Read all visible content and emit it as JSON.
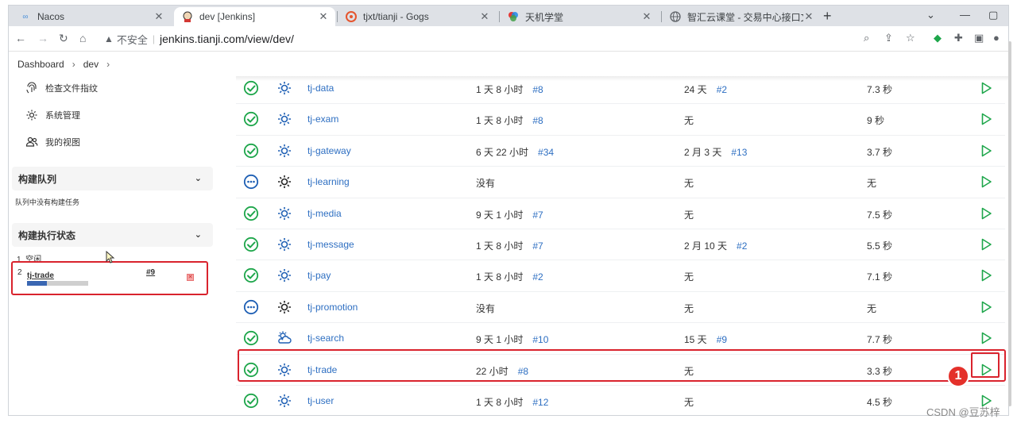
{
  "browser": {
    "tabs": [
      {
        "title": "Nacos",
        "favicon": "infinity-icon",
        "color": "#4a90d9"
      },
      {
        "title": "dev [Jenkins]",
        "favicon": "jenkins-icon",
        "color": "#d33833"
      },
      {
        "title": "tjxt/tianji - Gogs",
        "favicon": "gogs-icon",
        "color": "#e5552e"
      },
      {
        "title": "天机学堂",
        "favicon": "tianji-icon",
        "color": "#4caf50"
      },
      {
        "title": "智汇云课堂 - 交易中心接口文档",
        "favicon": "globe-icon",
        "color": "#5f6368"
      }
    ],
    "insecure_label": "不安全",
    "url": "jenkins.tianji.com/view/dev/"
  },
  "breadcrumb": {
    "root": "Dashboard",
    "current": "dev"
  },
  "sidebar": {
    "links": [
      {
        "label": "检查文件指纹",
        "icon": "fingerprint-icon"
      },
      {
        "label": "系统管理",
        "icon": "gear-icon"
      },
      {
        "label": "我的视图",
        "icon": "people-icon"
      }
    ],
    "build_queue": {
      "title": "构建队列",
      "empty_text": "队列中没有构建任务"
    },
    "executor_status": {
      "title": "构建执行状态",
      "executors": [
        {
          "number": "1",
          "state": "空闲"
        },
        {
          "number": "2",
          "job": "tj-trade",
          "build": "#9",
          "progress": 0.32
        }
      ]
    }
  },
  "jobs": [
    {
      "name": "tj-data",
      "status": "success",
      "weather": "sunny",
      "last_success": "1 天 8 小时",
      "last_success_build": "#8",
      "last_failure": "24 天",
      "last_failure_build": "#2",
      "duration": "7.3 秒"
    },
    {
      "name": "tj-exam",
      "status": "success",
      "weather": "sunny",
      "last_success": "1 天 8 小时",
      "last_success_build": "#8",
      "last_failure": "无",
      "last_failure_build": "",
      "duration": "9 秒"
    },
    {
      "name": "tj-gateway",
      "status": "success",
      "weather": "sunny",
      "last_success": "6 天 22 小时",
      "last_success_build": "#34",
      "last_failure": "2 月 3 天",
      "last_failure_build": "#13",
      "duration": "3.7 秒"
    },
    {
      "name": "tj-learning",
      "status": "notbuilt",
      "weather": "sunny-dark",
      "last_success": "没有",
      "last_success_build": "",
      "last_failure": "无",
      "last_failure_build": "",
      "duration": "无"
    },
    {
      "name": "tj-media",
      "status": "success",
      "weather": "sunny",
      "last_success": "9 天 1 小时",
      "last_success_build": "#7",
      "last_failure": "无",
      "last_failure_build": "",
      "duration": "7.5 秒"
    },
    {
      "name": "tj-message",
      "status": "success",
      "weather": "sunny",
      "last_success": "1 天 8 小时",
      "last_success_build": "#7",
      "last_failure": "2 月 10 天",
      "last_failure_build": "#2",
      "duration": "5.5 秒"
    },
    {
      "name": "tj-pay",
      "status": "success",
      "weather": "sunny",
      "last_success": "1 天 8 小时",
      "last_success_build": "#2",
      "last_failure": "无",
      "last_failure_build": "",
      "duration": "7.1 秒"
    },
    {
      "name": "tj-promotion",
      "status": "notbuilt",
      "weather": "sunny-dark",
      "last_success": "没有",
      "last_success_build": "",
      "last_failure": "无",
      "last_failure_build": "",
      "duration": "无"
    },
    {
      "name": "tj-search",
      "status": "success",
      "weather": "cloudy",
      "last_success": "9 天 1 小时",
      "last_success_build": "#10",
      "last_failure": "15 天",
      "last_failure_build": "#9",
      "duration": "7.7 秒"
    },
    {
      "name": "tj-trade",
      "status": "success",
      "weather": "sunny",
      "last_success": "22 小时",
      "last_success_build": "#8",
      "last_failure": "无",
      "last_failure_build": "",
      "duration": "3.3 秒"
    },
    {
      "name": "tj-user",
      "status": "success",
      "weather": "sunny",
      "last_success": "1 天 8 小时",
      "last_success_build": "#12",
      "last_failure": "无",
      "last_failure_build": "",
      "duration": "4.5 秒"
    }
  ],
  "annotation": {
    "badge": "1"
  },
  "watermark": "CSDN @豆苏梓",
  "colors": {
    "success": "#1ea64b",
    "notbuilt": "#1e5fb4",
    "link": "#2e6fc2",
    "highlight": "#d9232d",
    "run": "#1ea64b"
  }
}
